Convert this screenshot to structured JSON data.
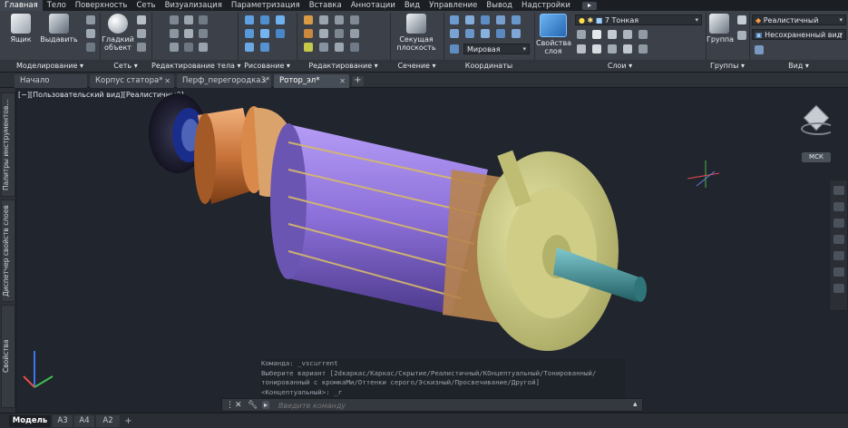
{
  "ribbon_tabs": [
    "Главная",
    "Тело",
    "Поверхность",
    "Сеть",
    "Визуализация",
    "Параметризация",
    "Вставка",
    "Аннотации",
    "Вид",
    "Управление",
    "Вывод",
    "Надстройки"
  ],
  "ribbon": {
    "modeling": {
      "box_label": "Ящик",
      "extrude_label": "Выдавить",
      "title": "Моделирование ▾"
    },
    "mesh": {
      "smooth_label": "Гладкий\nобъект",
      "title": "Сеть ▾"
    },
    "solid_editing": {
      "title": "Редактирование тела ▾"
    },
    "drawing": {
      "title": "Рисование ▾"
    },
    "modify": {
      "title": "Редактирование ▾"
    },
    "section": {
      "plane_label": "Секущая\nплоскость",
      "title": "Сечение ▾"
    },
    "coordinates": {
      "ucs_value": "Мировая",
      "title": "Координаты"
    },
    "layers": {
      "props_label": "Свойства\nслоя",
      "layer_value": "7 Тонкая",
      "title": "Слои ▾"
    },
    "groups": {
      "group_label": "Группа",
      "title": "Группы ▾"
    },
    "view": {
      "visual_style": "Реалистичный",
      "named_view": "Несохраненный вид",
      "title": "Вид ▾"
    }
  },
  "file_tabs": [
    {
      "label": "Начало",
      "closable": false
    },
    {
      "label": "Корпус статора*",
      "closable": true
    },
    {
      "label": "Перф_перегородка3*",
      "closable": true
    },
    {
      "label": "Ротор_эл*",
      "closable": true
    }
  ],
  "viewport": {
    "view_controls": "[−][Пользовательский вид][Реалистичный]",
    "ucs_badge": "МСК"
  },
  "palettes": [
    "Палитры инструментов...",
    "Диспетчер свойств слоев",
    "Свойства"
  ],
  "command": {
    "history": [
      "Команда: _vscurrent",
      "Выберите вариант [2dкаркас/Каркас/Скрытие/Реалистичный/КОнцептуальный/Тонированный/",
      "тонированный с кромкаМи/Оттенки серого/Эскизный/Просвечивание/Другой]",
      "<Концептуальный>: _r"
    ],
    "placeholder": "Введите команду"
  },
  "layout_tabs": [
    "Модель",
    "А3",
    "А4",
    "А2"
  ],
  "colors": {
    "accent": "#2f86d9",
    "armature_purple": "#8a6fd8",
    "copper": "#c8733a",
    "fan_yellow": "#d6d48a",
    "shaft": "#3d8a90"
  }
}
